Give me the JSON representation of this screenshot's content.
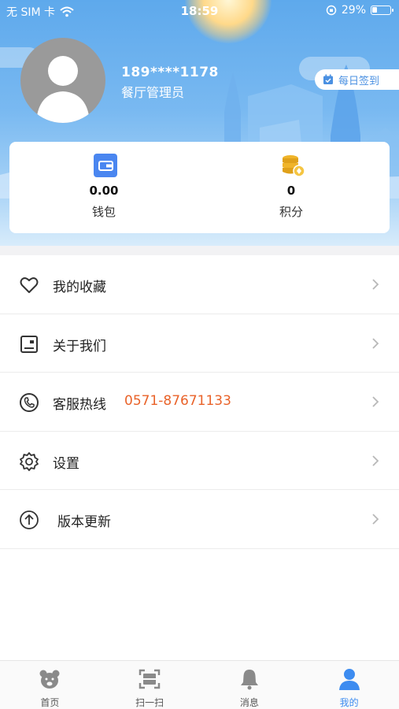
{
  "status_bar": {
    "carrier": "无 SIM 卡",
    "time": "18:59",
    "battery": "29%",
    "battery_level": 0.29
  },
  "profile": {
    "phone": "189****1178",
    "role": "餐厅管理员",
    "checkin_label": "每日签到"
  },
  "stats": [
    {
      "value": "0.00",
      "label": "钱包",
      "icon": "wallet-icon"
    },
    {
      "value": "0",
      "label": "积分",
      "icon": "coins-icon"
    }
  ],
  "menu": [
    {
      "label": "我的收藏",
      "icon": "heart-icon",
      "extra": ""
    },
    {
      "label": "关于我们",
      "icon": "info-card-icon",
      "extra": ""
    },
    {
      "label": "客服热线",
      "icon": "phone-icon",
      "extra": "0571-87671133"
    },
    {
      "label": "设置",
      "icon": "gear-icon",
      "extra": ""
    },
    {
      "label": "版本更新",
      "icon": "upload-icon",
      "extra": ""
    }
  ],
  "tabs": [
    {
      "label": "首页",
      "icon": "bear-icon",
      "active": false
    },
    {
      "label": "扫一扫",
      "icon": "scan-icon",
      "active": false
    },
    {
      "label": "消息",
      "icon": "bell-icon",
      "active": false
    },
    {
      "label": "我的",
      "icon": "person-icon",
      "active": true
    }
  ],
  "colors": {
    "accent": "#3d8cf0",
    "hotline": "#e9632a",
    "header_top": "#5ea9ec"
  }
}
